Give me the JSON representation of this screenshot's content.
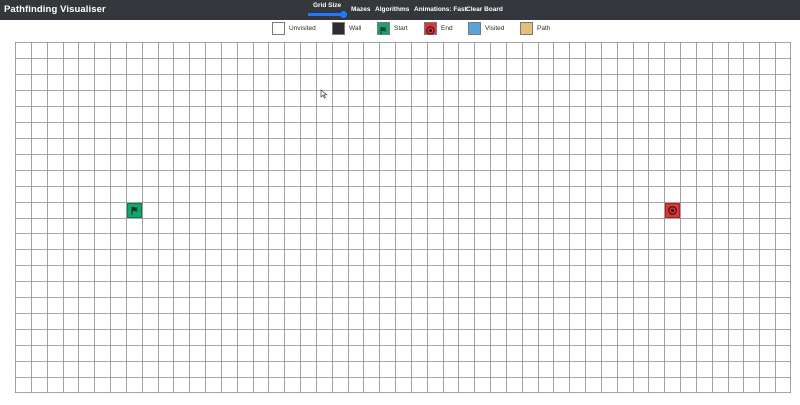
{
  "app": {
    "title": "Pathfinding Visualiser"
  },
  "nav": {
    "grid_size_label": "Grid Size",
    "grid_size_level": 0.92,
    "mazes": "Mazes",
    "algorithms": "Algorithms",
    "animations": "Animations: Fast",
    "clear_board": "Clear Board"
  },
  "legend": [
    {
      "label": "Unvisited",
      "color": "#ffffff",
      "icon": ""
    },
    {
      "label": "Wall",
      "color": "#2b2d30",
      "icon": ""
    },
    {
      "label": "Start",
      "color": "#16a46c",
      "icon": "flag-icon"
    },
    {
      "label": "End",
      "color": "#d7383c",
      "icon": "target-icon"
    },
    {
      "label": "Visited",
      "color": "#5aa2d8",
      "icon": ""
    },
    {
      "label": "Path",
      "color": "#e3c07a",
      "icon": ""
    }
  ],
  "grid": {
    "rows": 22,
    "cols": 49,
    "line_color": "#8a8a8a"
  },
  "start_node": {
    "row": 10,
    "col": 7
  },
  "end_node": {
    "row": 10,
    "col": 41
  }
}
